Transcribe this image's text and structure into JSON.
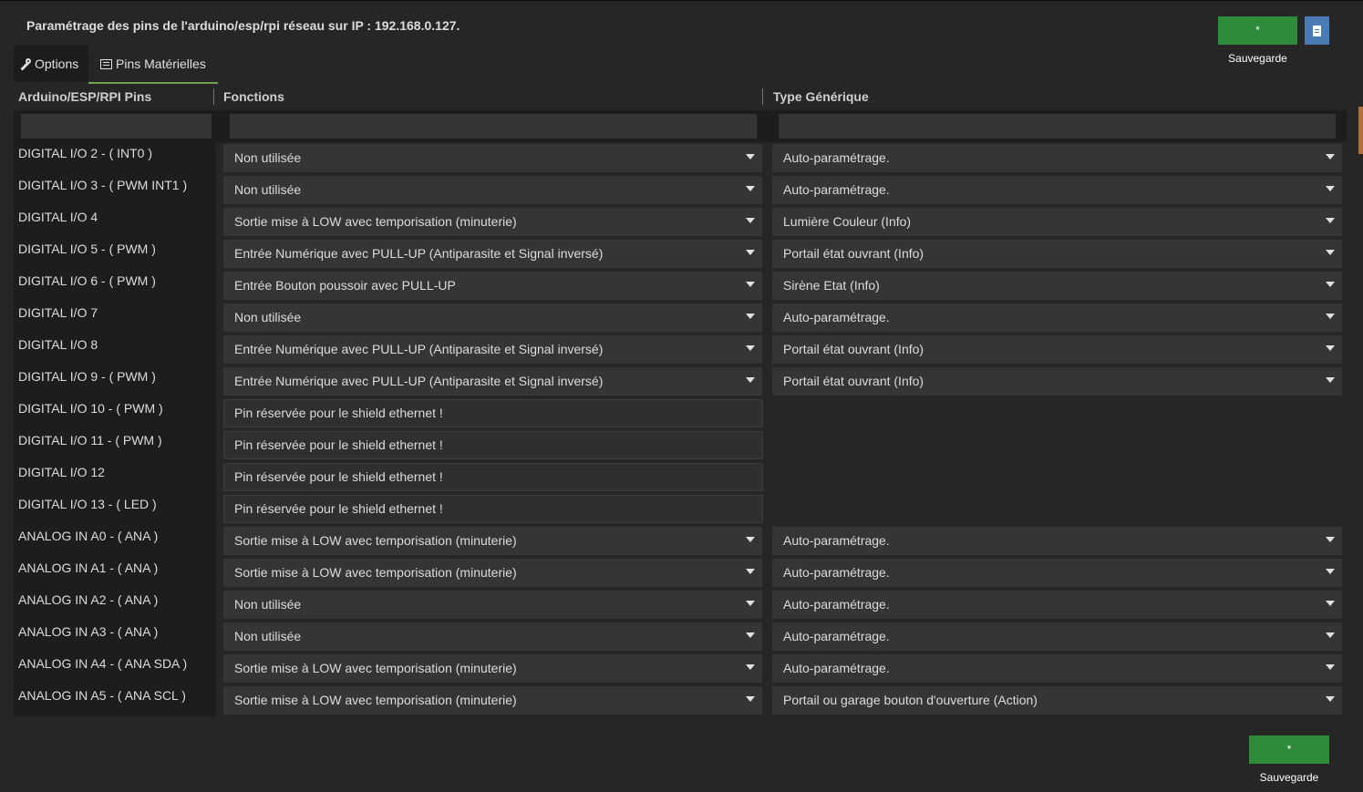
{
  "header": {
    "title": "Paramétrage des pins de l'arduino/esp/rpi réseau sur IP : 192.168.0.127.",
    "save_label": "* Sauvegarde",
    "doc_icon": "document-icon"
  },
  "tabs": [
    {
      "label": "Options",
      "icon": "wrench-icon"
    },
    {
      "label": "Pins Matérielles",
      "icon": "list-icon",
      "active": true
    }
  ],
  "columns": [
    "Arduino/ESP/RPI Pins",
    "Fonctions",
    "Type Générique"
  ],
  "filters": {
    "pins": "",
    "fonctions": "",
    "type": ""
  },
  "rows": [
    {
      "pin": "DIGITAL I/O 2 - ( INT0 )",
      "fonction": "Non utilisée",
      "type": "Auto-paramétrage."
    },
    {
      "pin": "DIGITAL I/O 3 - ( PWM INT1 )",
      "fonction": "Non utilisée",
      "type": "Auto-paramétrage."
    },
    {
      "pin": "DIGITAL I/O 4",
      "fonction": "Sortie mise à LOW avec temporisation (minuterie)",
      "type": "Lumière Couleur (Info)"
    },
    {
      "pin": "DIGITAL I/O 5 - ( PWM )",
      "fonction": "Entrée Numérique avec PULL-UP (Antiparasite et Signal inversé)",
      "type": "Portail état ouvrant (Info)"
    },
    {
      "pin": "DIGITAL I/O 6 - ( PWM )",
      "fonction": "Entrée Bouton poussoir avec PULL-UP",
      "type": "Sirène Etat (Info)"
    },
    {
      "pin": "DIGITAL I/O 7",
      "fonction": "Non utilisée",
      "type": "Auto-paramétrage."
    },
    {
      "pin": "DIGITAL I/O 8",
      "fonction": "Entrée Numérique avec PULL-UP (Antiparasite et Signal inversé)",
      "type": "Portail état ouvrant (Info)"
    },
    {
      "pin": "DIGITAL I/O 9 - ( PWM )",
      "fonction": "Entrée Numérique avec PULL-UP (Antiparasite et Signal inversé)",
      "type": "Portail état ouvrant (Info)"
    },
    {
      "pin": "DIGITAL I/O 10 - ( PWM )",
      "reserved": "Pin réservée pour le shield ethernet !"
    },
    {
      "pin": "DIGITAL I/O 11 - ( PWM )",
      "reserved": "Pin réservée pour le shield ethernet !"
    },
    {
      "pin": "DIGITAL I/O 12",
      "reserved": "Pin réservée pour le shield ethernet !"
    },
    {
      "pin": "DIGITAL I/O 13 - ( LED )",
      "reserved": "Pin réservée pour le shield ethernet !"
    },
    {
      "pin": "ANALOG IN A0 - ( ANA )",
      "fonction": "Sortie mise à LOW avec temporisation (minuterie)",
      "type": "Auto-paramétrage."
    },
    {
      "pin": "ANALOG IN A1 - ( ANA )",
      "fonction": "Sortie mise à LOW avec temporisation (minuterie)",
      "type": "Auto-paramétrage."
    },
    {
      "pin": "ANALOG IN A2 - ( ANA )",
      "fonction": "Non utilisée",
      "type": "Auto-paramétrage."
    },
    {
      "pin": "ANALOG IN A3 - ( ANA )",
      "fonction": "Non utilisée",
      "type": "Auto-paramétrage."
    },
    {
      "pin": "ANALOG IN A4 - ( ANA SDA )",
      "fonction": "Sortie mise à LOW avec temporisation (minuterie)",
      "type": "Auto-paramétrage."
    },
    {
      "pin": "ANALOG IN A5 - ( ANA SCL )",
      "fonction": "Sortie mise à LOW avec temporisation (minuterie)",
      "type": "Portail ou garage bouton d'ouverture (Action)"
    }
  ],
  "colors": {
    "save": "#2e8b3a",
    "doc": "#4a7bb5",
    "tab_underline": "#6fa24a"
  }
}
